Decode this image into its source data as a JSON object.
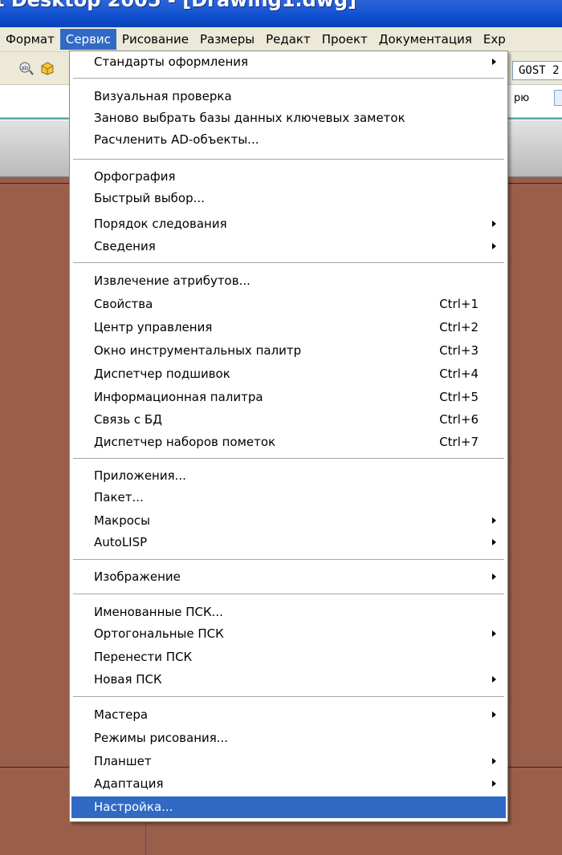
{
  "window": {
    "title": "t Desktop 2005 - [Drawing1.dwg]"
  },
  "menubar": {
    "items": [
      {
        "label": "Формат"
      },
      {
        "label": "Сервис",
        "active": true
      },
      {
        "label": "Рисование"
      },
      {
        "label": "Размеры"
      },
      {
        "label": "Редакт"
      },
      {
        "label": "Проект"
      },
      {
        "label": "Документация"
      },
      {
        "label": "Exp"
      }
    ]
  },
  "toolbar": {
    "style_value": "GOST 2",
    "partial_text": "рю"
  },
  "menu": {
    "items": [
      {
        "label": "Стандарты оформления",
        "submenu": true
      },
      {
        "label": "Визуальная проверка"
      },
      {
        "label": "Заново выбрать базы данных ключевых заметок"
      },
      {
        "label": "Расчленить AD-объекты..."
      },
      {
        "label": "Орфография"
      },
      {
        "label": "Быстрый выбор..."
      },
      {
        "label": "Порядок следования",
        "submenu": true
      },
      {
        "label": "Сведения",
        "submenu": true
      },
      {
        "label": "Извлечение атрибутов..."
      },
      {
        "label": "Свойства",
        "shortcut": "Ctrl+1"
      },
      {
        "label": "Центр управления",
        "shortcut": "Ctrl+2"
      },
      {
        "label": "Окно инструментальных палитр",
        "shortcut": "Ctrl+3"
      },
      {
        "label": "Диспетчер подшивок",
        "shortcut": "Ctrl+4"
      },
      {
        "label": "Информационная палитра",
        "shortcut": "Ctrl+5"
      },
      {
        "label": "Связь с БД",
        "shortcut": "Ctrl+6"
      },
      {
        "label": "Диспетчер наборов пометок",
        "shortcut": "Ctrl+7"
      },
      {
        "label": "Приложения..."
      },
      {
        "label": "Пакет..."
      },
      {
        "label": "Макросы",
        "submenu": true
      },
      {
        "label": "AutoLISP",
        "submenu": true
      },
      {
        "label": "Изображение",
        "submenu": true
      },
      {
        "label": "Именованные ПСК..."
      },
      {
        "label": "Ортогональные ПСК",
        "submenu": true
      },
      {
        "label": "Перенести ПСК"
      },
      {
        "label": "Новая ПСК",
        "submenu": true
      },
      {
        "label": "Мастера",
        "submenu": true
      },
      {
        "label": "Режимы рисования..."
      },
      {
        "label": "Планшет",
        "submenu": true
      },
      {
        "label": "Адаптация",
        "submenu": true
      },
      {
        "label": "Настройка...",
        "selected": true
      }
    ]
  },
  "colors": {
    "accent": "#316ac5",
    "canvas": "#9a5f4a",
    "menu_bg": "#ffffff",
    "bar_bg": "#ece9d8"
  }
}
